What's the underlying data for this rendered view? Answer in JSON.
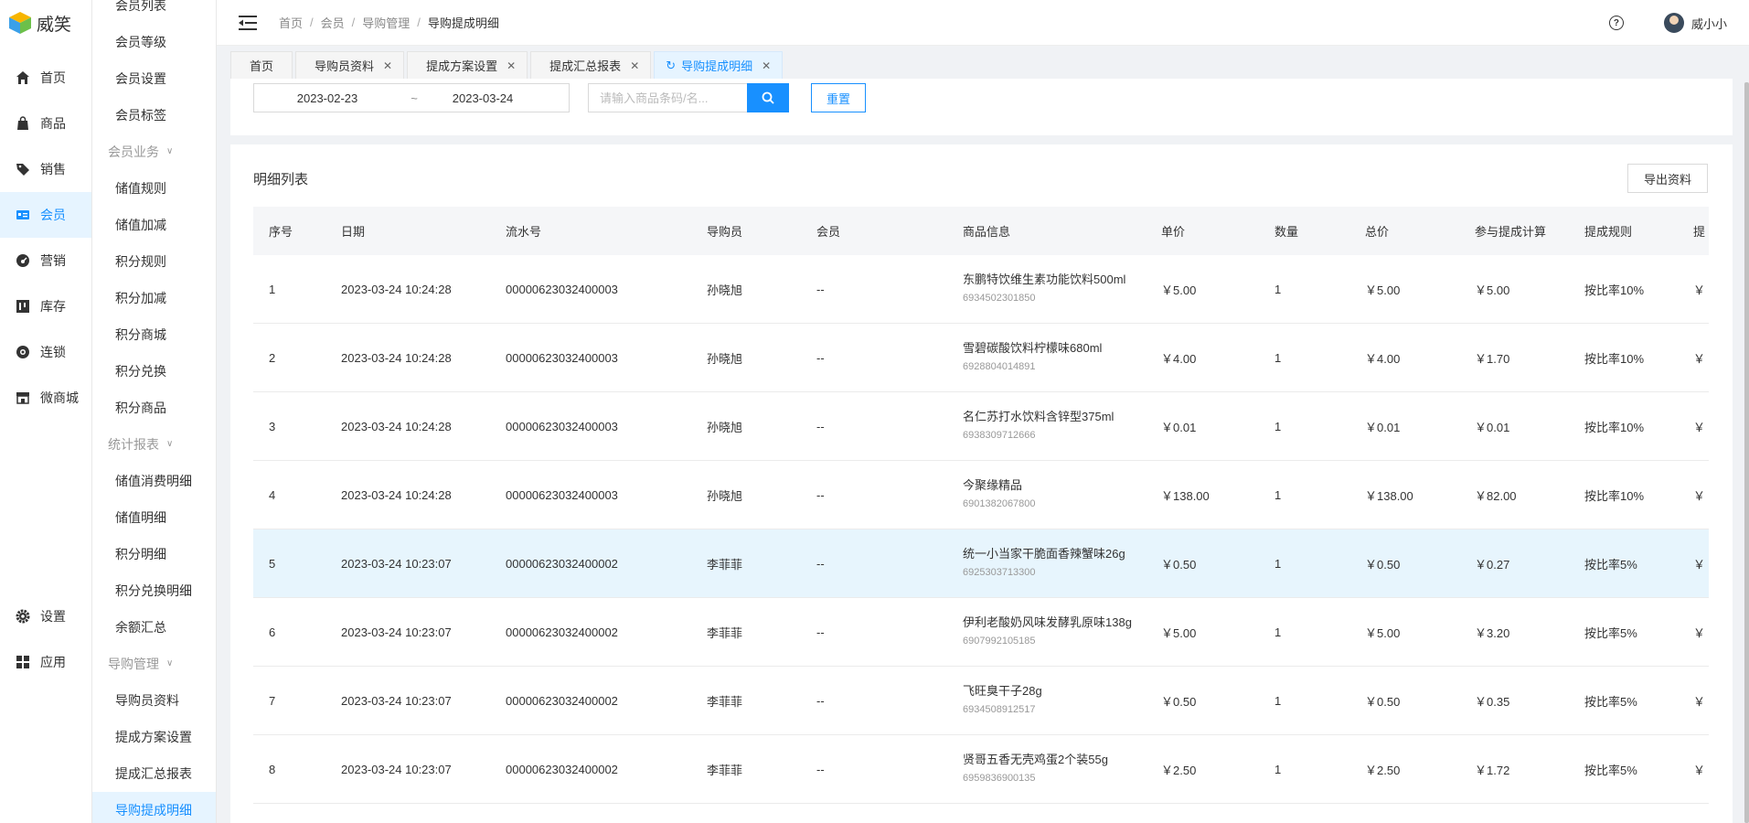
{
  "app": {
    "name": "威笑"
  },
  "nav": [
    {
      "label": "首页",
      "icon": "home-icon"
    },
    {
      "label": "商品",
      "icon": "bag-icon"
    },
    {
      "label": "销售",
      "icon": "tag-icon"
    },
    {
      "label": "会员",
      "icon": "member-card-icon"
    },
    {
      "label": "营销",
      "icon": "gauge-icon"
    },
    {
      "label": "库存",
      "icon": "inventory-icon"
    },
    {
      "label": "连锁",
      "icon": "chain-icon"
    },
    {
      "label": "微商城",
      "icon": "store-icon"
    },
    {
      "label": "设置",
      "icon": "gear-icon"
    },
    {
      "label": "应用",
      "icon": "apps-icon"
    }
  ],
  "submenu": {
    "items_top": [
      "会员列表",
      "会员等级",
      "会员设置",
      "会员标签"
    ],
    "group1": "会员业务",
    "items_g1": [
      "储值规则",
      "储值加减",
      "积分规则",
      "积分加减",
      "积分商城",
      "积分兑换",
      "积分商品"
    ],
    "group2": "统计报表",
    "items_g2": [
      "储值消费明细",
      "储值明细",
      "积分明细",
      "积分兑换明细",
      "余额汇总"
    ],
    "group3": "导购管理",
    "items_g3": [
      "导购员资料",
      "提成方案设置",
      "提成汇总报表",
      "导购提成明细"
    ]
  },
  "breadcrumb": [
    "首页",
    "会员",
    "导购管理",
    "导购提成明细"
  ],
  "user": {
    "name": "威小小"
  },
  "tabs": [
    "首页",
    "导购员资料",
    "提成方案设置",
    "提成汇总报表",
    "导购提成明细"
  ],
  "filter": {
    "date_start": "2023-02-23",
    "date_sep": "~",
    "date_end": "2023-03-24",
    "search_placeholder": "请输入商品条码/名...",
    "reset_label": "重置"
  },
  "card": {
    "title": "明细列表",
    "export_label": "导出资料"
  },
  "table": {
    "columns": [
      "序号",
      "日期",
      "流水号",
      "导购员",
      "会员",
      "商品信息",
      "单价",
      "数量",
      "总价",
      "参与提成计算",
      "提成规则",
      "提"
    ],
    "rows": [
      {
        "idx": "1",
        "date": "2023-03-24 10:24:28",
        "sn": "00000623032400003",
        "guide": "孙晓旭",
        "member": "--",
        "goods": "东鹏特饮维生素功能饮料500ml",
        "code": "6934502301850",
        "price": "￥5.00",
        "qty": "1",
        "total": "￥5.00",
        "calc": "￥5.00",
        "rule": "按比率10%",
        "comm": "￥"
      },
      {
        "idx": "2",
        "date": "2023-03-24 10:24:28",
        "sn": "00000623032400003",
        "guide": "孙晓旭",
        "member": "--",
        "goods": "雪碧碳酸饮料柠檬味680ml",
        "code": "6928804014891",
        "price": "￥4.00",
        "qty": "1",
        "total": "￥4.00",
        "calc": "￥1.70",
        "rule": "按比率10%",
        "comm": "￥"
      },
      {
        "idx": "3",
        "date": "2023-03-24 10:24:28",
        "sn": "00000623032400003",
        "guide": "孙晓旭",
        "member": "--",
        "goods": "名仁苏打水饮料含锌型375ml",
        "code": "6938309712666",
        "price": "￥0.01",
        "qty": "1",
        "total": "￥0.01",
        "calc": "￥0.01",
        "rule": "按比率10%",
        "comm": "￥"
      },
      {
        "idx": "4",
        "date": "2023-03-24 10:24:28",
        "sn": "00000623032400003",
        "guide": "孙晓旭",
        "member": "--",
        "goods": "今聚缘精品",
        "code": "6901382067800",
        "price": "￥138.00",
        "qty": "1",
        "total": "￥138.00",
        "calc": "￥82.00",
        "rule": "按比率10%",
        "comm": "￥"
      },
      {
        "idx": "5",
        "date": "2023-03-24 10:23:07",
        "sn": "00000623032400002",
        "guide": "李菲菲",
        "member": "--",
        "goods": "统一小当家干脆面香辣蟹味26g",
        "code": "6925303713300",
        "price": "￥0.50",
        "qty": "1",
        "total": "￥0.50",
        "calc": "￥0.27",
        "rule": "按比率5%",
        "comm": "￥"
      },
      {
        "idx": "6",
        "date": "2023-03-24 10:23:07",
        "sn": "00000623032400002",
        "guide": "李菲菲",
        "member": "--",
        "goods": "伊利老酸奶风味发酵乳原味138g",
        "code": "6907992105185",
        "price": "￥5.00",
        "qty": "1",
        "total": "￥5.00",
        "calc": "￥3.20",
        "rule": "按比率5%",
        "comm": "￥"
      },
      {
        "idx": "7",
        "date": "2023-03-24 10:23:07",
        "sn": "00000623032400002",
        "guide": "李菲菲",
        "member": "--",
        "goods": "飞旺臭干子28g",
        "code": "6934508912517",
        "price": "￥0.50",
        "qty": "1",
        "total": "￥0.50",
        "calc": "￥0.35",
        "rule": "按比率5%",
        "comm": "￥"
      },
      {
        "idx": "8",
        "date": "2023-03-24 10:23:07",
        "sn": "00000623032400002",
        "guide": "李菲菲",
        "member": "--",
        "goods": "贤哥五香无壳鸡蛋2个装55g",
        "code": "6959836900135",
        "price": "￥2.50",
        "qty": "1",
        "total": "￥2.50",
        "calc": "￥1.72",
        "rule": "按比率5%",
        "comm": "￥"
      }
    ]
  },
  "colors": {
    "accent": "#1890ff",
    "highlight_row": "#e7f5fd",
    "active_menu_bg": "#e6f4ff"
  }
}
